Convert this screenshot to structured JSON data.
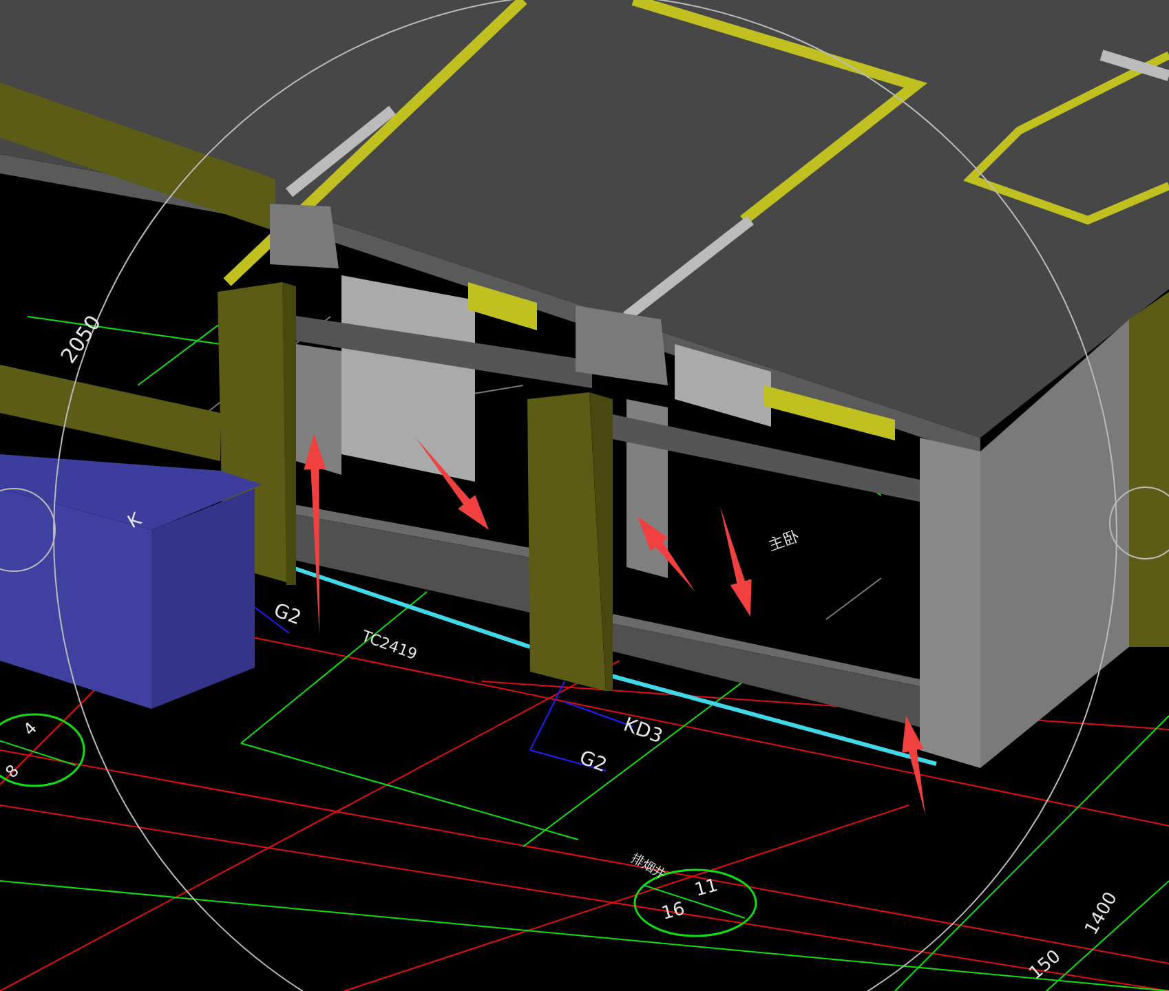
{
  "viewport": {
    "labels": [
      {
        "text": "2050"
      },
      {
        "text": "K"
      },
      {
        "text": "G2"
      },
      {
        "text": "TC2419"
      },
      {
        "text": "KD3"
      },
      {
        "text": "G2"
      },
      {
        "text": "4"
      },
      {
        "text": "8"
      },
      {
        "text": "11"
      },
      {
        "text": "16"
      },
      {
        "text": "排烟井"
      },
      {
        "text": "主卧"
      },
      {
        "text": "1400"
      },
      {
        "text": "150"
      }
    ]
  }
}
